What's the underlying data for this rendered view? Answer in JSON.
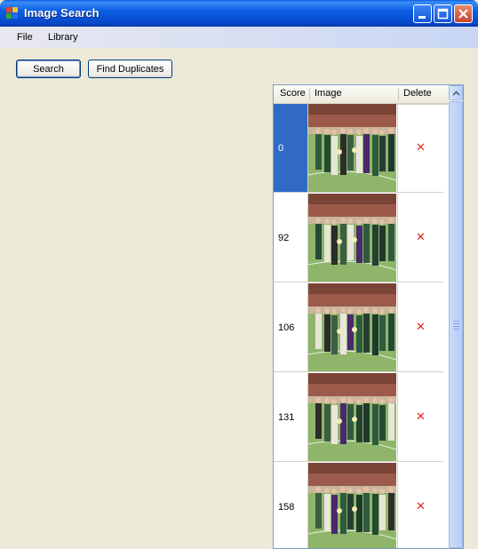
{
  "window": {
    "title": "Image Search"
  },
  "menu": {
    "items": [
      "File",
      "Library"
    ]
  },
  "toolbar": {
    "search_label": "Search",
    "find_duplicates_label": "Find Duplicates"
  },
  "grid": {
    "columns": [
      "Score",
      "Image",
      "Delete"
    ],
    "rows": [
      {
        "score": "0",
        "selected": true
      },
      {
        "score": "92",
        "selected": false
      },
      {
        "score": "106",
        "selected": false
      },
      {
        "score": "131",
        "selected": false
      },
      {
        "score": "158",
        "selected": false
      }
    ],
    "delete_glyph": "✕"
  },
  "colors": {
    "titlebar": "#0a5ce6",
    "selection": "#316ac5",
    "delete_icon": "#e0251b"
  }
}
